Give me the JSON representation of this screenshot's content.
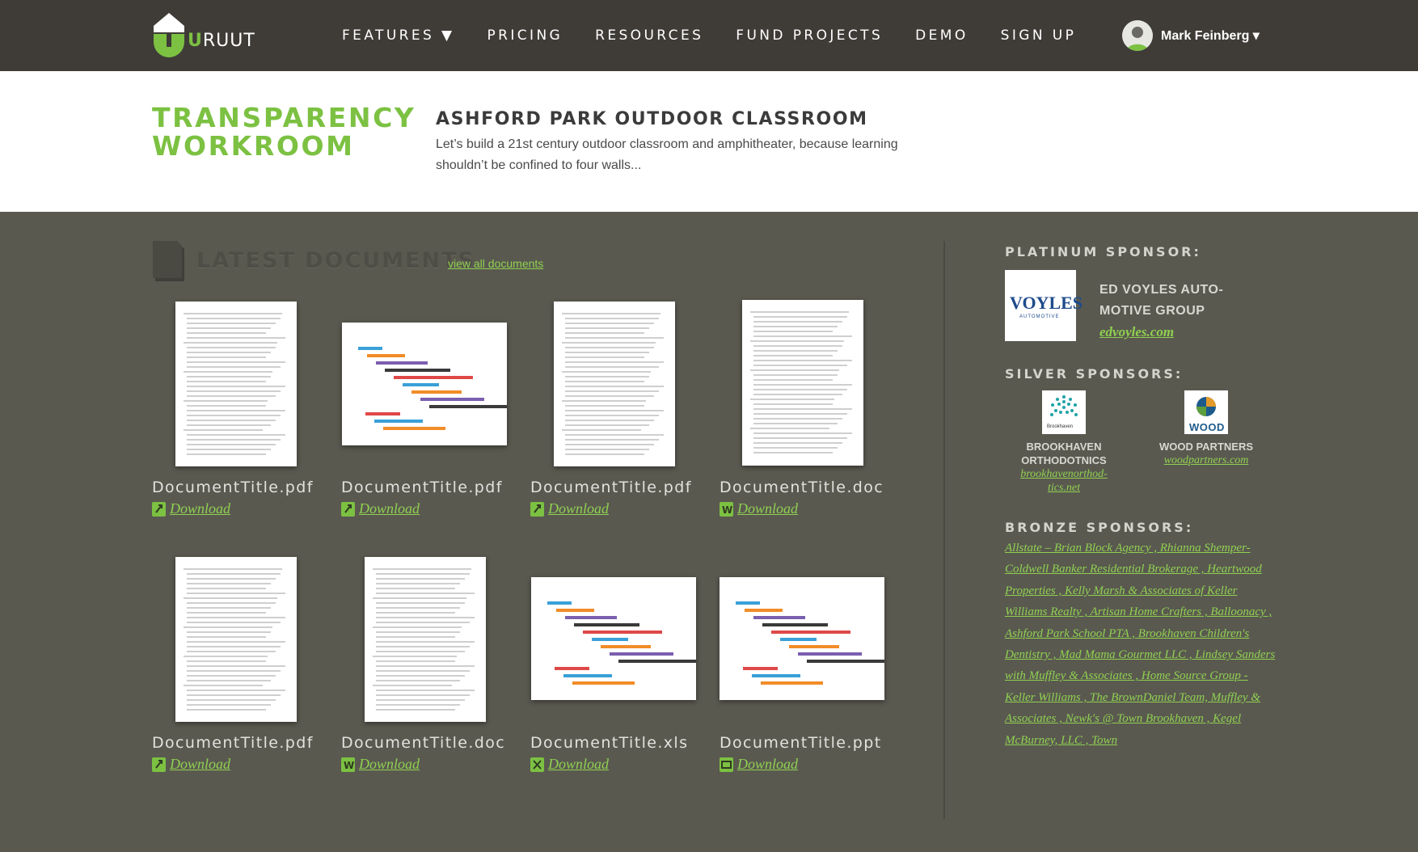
{
  "nav": {
    "logo_prefix": "U",
    "logo_suffix": "RUUT",
    "items": [
      "FEATURES ▼",
      "PRICING",
      "RESOURCES",
      "FUND PROJECTS",
      "DEMO",
      "SIGN UP"
    ],
    "user_name": "Mark Feinberg ▾"
  },
  "header": {
    "section_title_line1": "TRANSPARENCY",
    "section_title_line2": "WORKROOM",
    "project_title": "ASHFORD PARK OUTDOOR CLASSROOM",
    "project_desc": "Let’s build a 21st century outdoor classroom and amphitheater, because learning shouldn’t be confined to four walls..."
  },
  "documents": {
    "title": "LATEST DOCUMENTS",
    "view_all": "view all documents",
    "download_label": "Download",
    "items": [
      {
        "name": "DocumentTitle.pdf",
        "type": "pdf"
      },
      {
        "name": "DocumentTitle.pdf",
        "type": "pdf"
      },
      {
        "name": "DocumentTitle.pdf",
        "type": "pdf"
      },
      {
        "name": "DocumentTitle.doc",
        "type": "doc"
      },
      {
        "name": "DocumentTitle.pdf",
        "type": "pdf"
      },
      {
        "name": "DocumentTitle.doc",
        "type": "doc"
      },
      {
        "name": "DocumentTitle.xls",
        "type": "xls"
      },
      {
        "name": "DocumentTitle.ppt",
        "type": "ppt"
      }
    ]
  },
  "sponsors": {
    "platinum_heading": "PLATINUM SPONSOR:",
    "platinum": {
      "logo_text": "VOYLES",
      "logo_sub": "AUTOMOTIVE",
      "name": "ED VOYLES AUTO-MOTIVE GROUP",
      "url": "edvoyles.com"
    },
    "silver_heading": "SILVER SPONSORS:",
    "silver": [
      {
        "name": "BROOKHAVEN ORTHODOTNICS",
        "url": "brookhavenorthod-tics.net",
        "logo_text": "Brookhaven"
      },
      {
        "name": "WOOD PARTNERS",
        "url": "woodpartners.com",
        "logo_text": "WOOD"
      }
    ],
    "bronze_heading": "BRONZE SPONSORS:",
    "bronze": [
      "Allstate – Brian Block Agency",
      "Rhianna Shemper- Coldwell Banker Residential Brokerage",
      "Heartwood Properties",
      "Kelly Marsh & Associates of Keller Williams Realty",
      "Artisan Home Crafters",
      "Balloonacy",
      "Ashford Park School PTA",
      "Brookhaven Children's Dentistry",
      "Mad Mama Gourmet LLC",
      "Lindsey Sanders with Muffley & Associates",
      "Home Source Group - Keller Williams",
      "The BrownDaniel Team, Muffley & Associates",
      "Newk's @ Town Brookhaven",
      "Kegel McBurney, LLC",
      "Town"
    ]
  },
  "colors": {
    "accent": "#7cc142",
    "topbar": "#3f3c38",
    "background": "#5a5950"
  }
}
